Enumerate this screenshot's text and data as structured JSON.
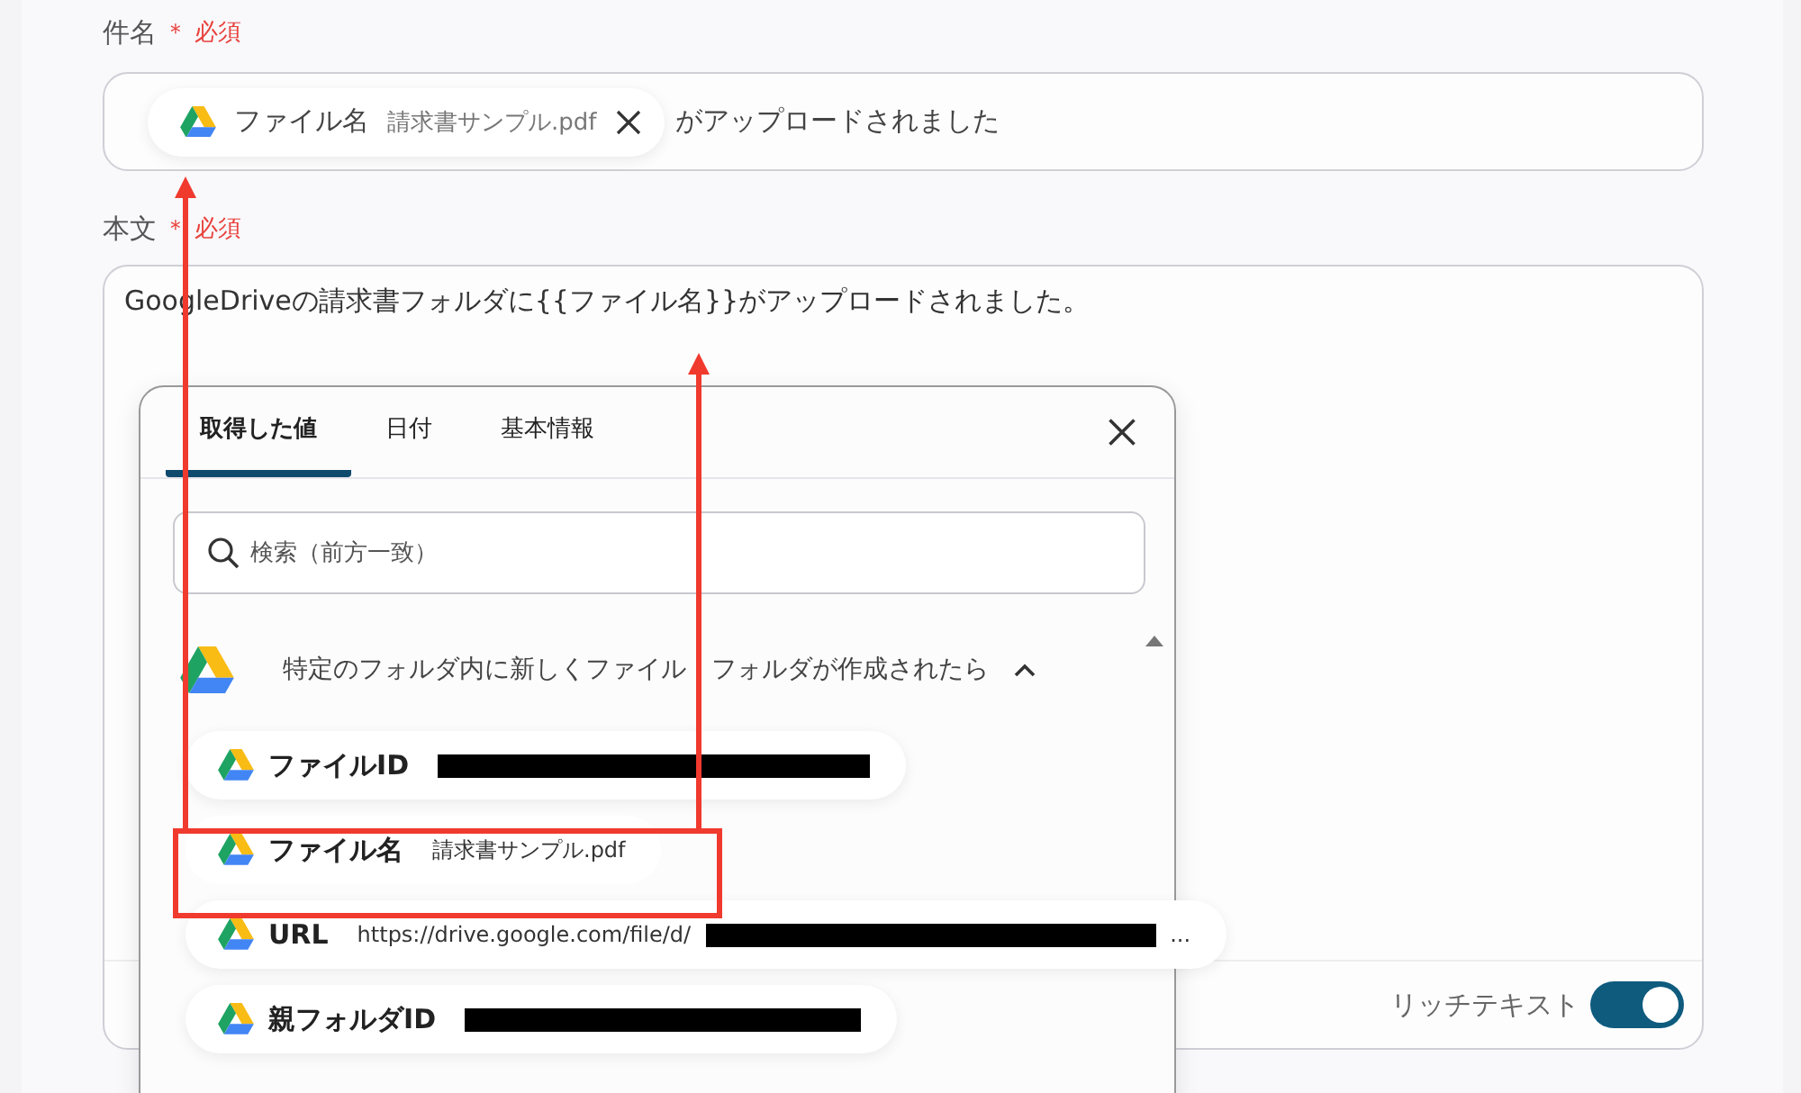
{
  "subject": {
    "label": "件名",
    "required_mark": "＊",
    "required_text": "必須",
    "chip": {
      "label": "ファイル名",
      "value": "請求書サンプル.pdf"
    },
    "suffix": "がアップロードされました"
  },
  "body": {
    "label": "本文",
    "required_mark": "＊",
    "required_text": "必須",
    "value": "GoogleDriveの請求書フォルダに{{ファイル名}}がアップロードされました。",
    "rich_text": {
      "label": "リッチテキスト",
      "on": true
    }
  },
  "popup": {
    "tabs": [
      {
        "label": "取得した値",
        "selected": true
      },
      {
        "label": "日付",
        "selected": false
      },
      {
        "label": "基本情報",
        "selected": false
      }
    ],
    "search": {
      "placeholder": "検索（前方一致）"
    },
    "group": {
      "title_parts": [
        "特定のフォルダ内に新しくファイル",
        "フォルダが作成されたら"
      ],
      "expanded": true
    },
    "items": [
      {
        "label": "ファイルID",
        "parts": [
          {
            "kind": "redacted"
          }
        ],
        "highlighted": false
      },
      {
        "label": "ファイル名",
        "parts": [
          {
            "kind": "text",
            "text": "請求書サンプル.pdf"
          }
        ],
        "highlighted": true
      },
      {
        "label": "URL",
        "parts": [
          {
            "kind": "text",
            "text": "https://drive.google.com/file/d/"
          },
          {
            "kind": "redacted"
          },
          {
            "kind": "text",
            "text": "..."
          }
        ],
        "highlighted": false
      },
      {
        "label": "親フォルダID",
        "parts": [
          {
            "kind": "redacted"
          }
        ],
        "highlighted": false
      }
    ]
  }
}
